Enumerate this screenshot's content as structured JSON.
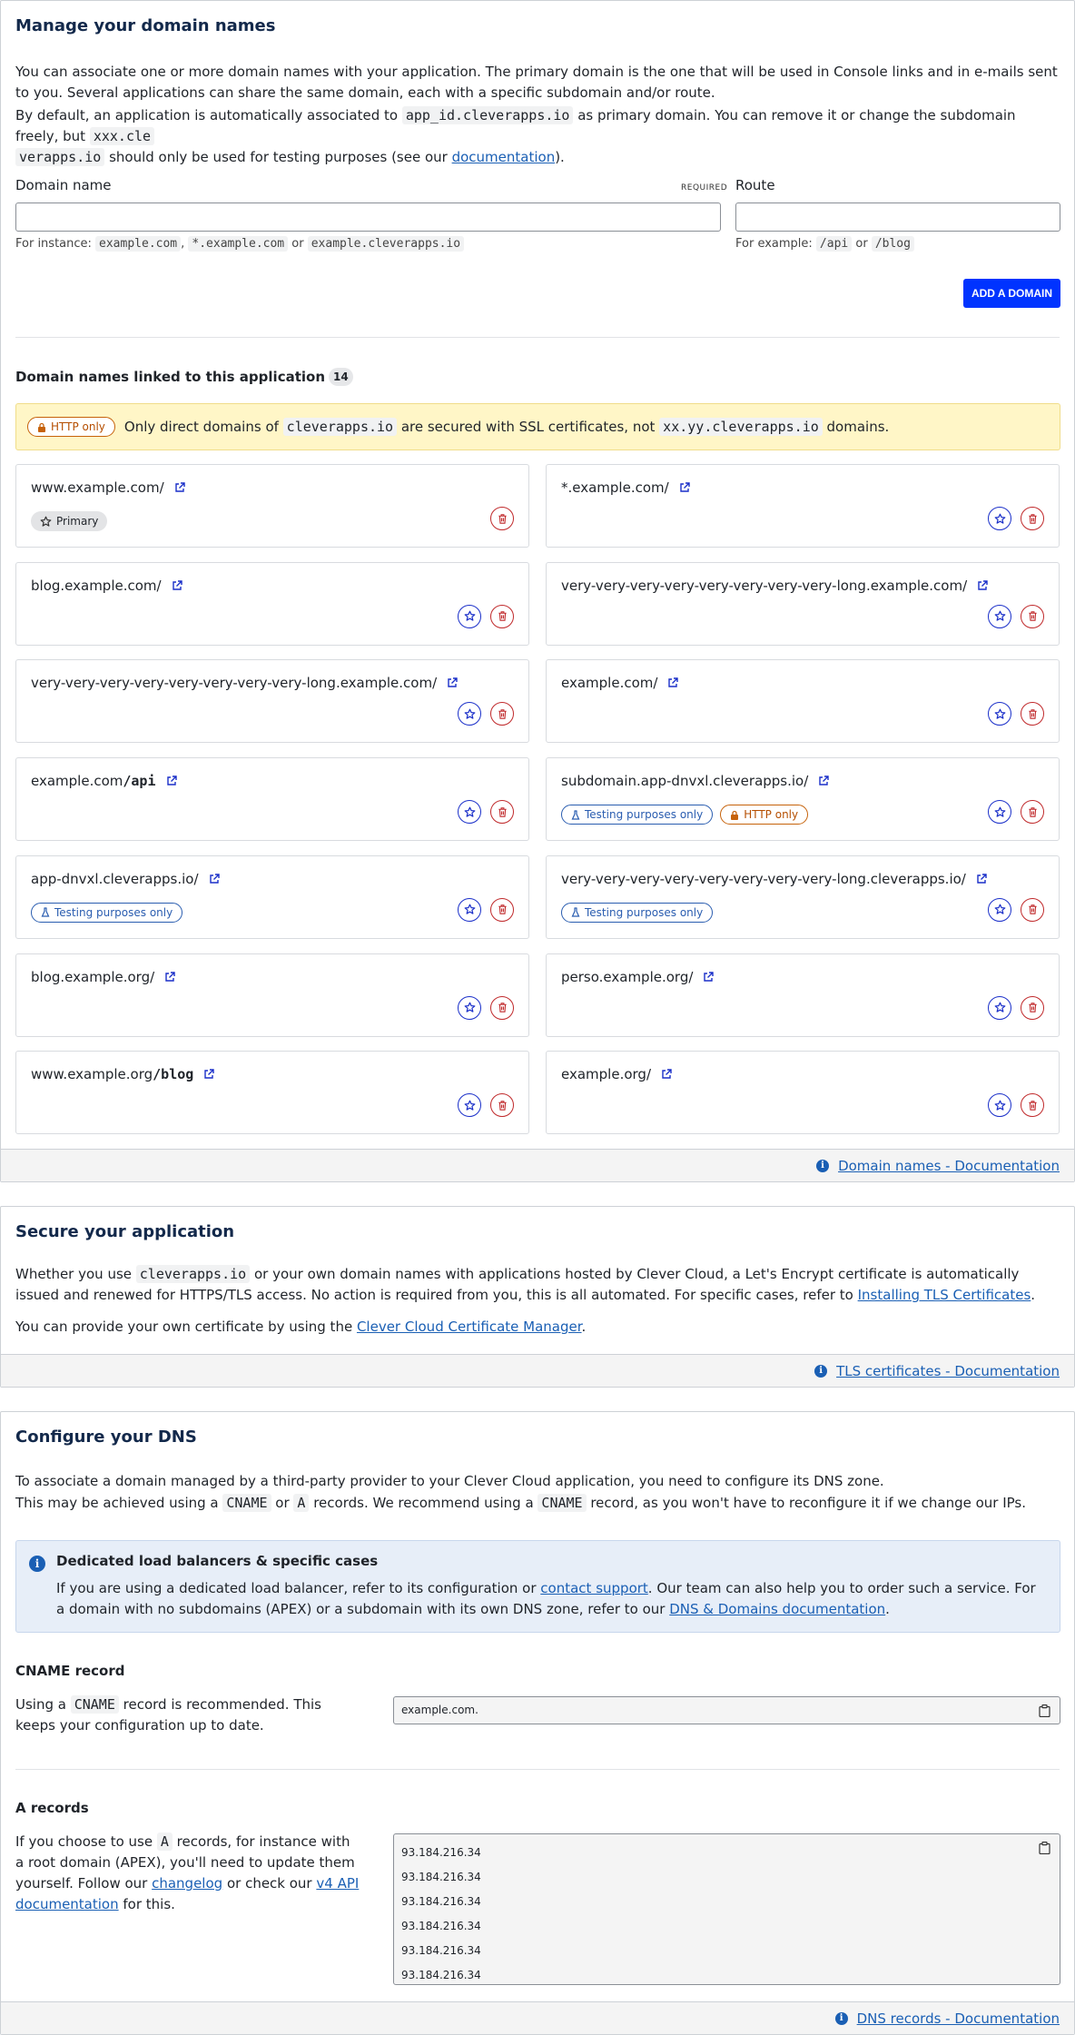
{
  "manage": {
    "title": "Manage your domain names",
    "intro1": "You can associate one or more domain names with your application. The primary domain is the one that will be used in Console links and in e-mails sent to you. Several applications can share the same domain, each with a specific subdomain and/or route.",
    "intro2_a": "By default, an application is automatically associated to ",
    "intro2_code1": "app_id.cleverapps.io",
    "intro2_b": " as primary domain. You can remove it or change the subdomain freely, but ",
    "intro2_code2a": "xxx.cle",
    "intro2_code2b": "verapps.io",
    "intro2_c": " should only be used for testing purposes (see our ",
    "intro2_link": "documentation",
    "intro2_d": ").",
    "domain_label": "Domain name",
    "required": "REQUIRED",
    "domain_value": "",
    "route_label": "Route",
    "route_value": "",
    "domain_hint_prefix": "For instance: ",
    "domain_hint_ex1": "example.com",
    "domain_hint_sep1": ", ",
    "domain_hint_ex2": "*.example.com",
    "domain_hint_sep2": " or ",
    "domain_hint_ex3": "example.cleverapps.io",
    "route_hint_prefix": "For example: ",
    "route_hint_ex1": "/api",
    "route_hint_sep": " or ",
    "route_hint_ex2": "/blog",
    "add_button": "ADD A DOMAIN",
    "linked_title": "Domain names linked to this application",
    "linked_count": "14",
    "warning_pill": "HTTP only",
    "warning_a": "Only direct domains of ",
    "warning_code1": "cleverapps.io",
    "warning_b": " are secured with SSL certificates, not ",
    "warning_code2": "xx.yy.cleverapps.io",
    "warning_c": " domains.",
    "footer_link": "Domain names - Documentation",
    "domains": [
      {
        "host": "www.example.com",
        "path": "/",
        "route": "",
        "pills": [
          {
            "type": "primary",
            "label": "Primary"
          }
        ],
        "primary": true
      },
      {
        "host": "*.example.com",
        "path": "/",
        "route": "",
        "pills": []
      },
      {
        "host": "blog.example.com",
        "path": "/",
        "route": "",
        "pills": []
      },
      {
        "host": "very-very-very-very-very-very-very-very-long.example.com",
        "path": "/",
        "route": "",
        "pills": []
      },
      {
        "host": "very-very-very-very-very-very-very-very-long.example.com",
        "path": "/",
        "route": "",
        "pills": []
      },
      {
        "host": "example.com",
        "path": "/",
        "route": "",
        "pills": []
      },
      {
        "host": "example.com",
        "path": "",
        "route": "/api",
        "pills": []
      },
      {
        "host": "subdomain.app-dnvxl.cleverapps.io",
        "path": "/",
        "route": "",
        "pills": [
          {
            "type": "test",
            "label": "Testing purposes only"
          },
          {
            "type": "http",
            "label": "HTTP only"
          }
        ]
      },
      {
        "host": "app-dnvxl.cleverapps.io",
        "path": "/",
        "route": "",
        "pills": [
          {
            "type": "test",
            "label": "Testing purposes only"
          }
        ]
      },
      {
        "host": "very-very-very-very-very-very-very-very-long.cleverapps.io",
        "path": "/",
        "route": "",
        "pills": [
          {
            "type": "test",
            "label": "Testing purposes only"
          }
        ]
      },
      {
        "host": "blog.example.org",
        "path": "/",
        "route": "",
        "pills": []
      },
      {
        "host": "perso.example.org",
        "path": "/",
        "route": "",
        "pills": []
      },
      {
        "host": "www.example.org",
        "path": "",
        "route": "/blog",
        "pills": []
      },
      {
        "host": "example.org",
        "path": "/",
        "route": "",
        "pills": []
      }
    ]
  },
  "secure": {
    "title": "Secure your application",
    "p1_a": "Whether you use ",
    "p1_code": "cleverapps.io",
    "p1_b": " or your own domain names with applications hosted by Clever Cloud, a Let's Encrypt certificate is automatically issued and renewed for HTTPS/TLS access. No action is required from you, this is all automated. For specific cases, refer to ",
    "p1_link": "Installing TLS Certificates",
    "p1_c": ".",
    "p2_a": "You can provide your own certificate by using the ",
    "p2_link": "Clever Cloud Certificate Manager",
    "p2_b": ".",
    "footer_link": "TLS certificates - Documentation"
  },
  "dns": {
    "title": "Configure your DNS",
    "p1": "To associate a domain managed by a third-party provider to your Clever Cloud application, you need to configure its DNS zone.",
    "p2_a": "This may be achieved using a ",
    "p2_code1": "CNAME",
    "p2_b": " or ",
    "p2_code2": "A",
    "p2_c": " records. We recommend using a ",
    "p2_code3": "CNAME",
    "p2_d": " record, as you won't have to reconfigure it if we change our IPs.",
    "box_title": "Dedicated load balancers & specific cases",
    "box_a": "If you are using a dedicated load balancer, refer to its configuration or ",
    "box_link1": "contact support",
    "box_b": ". Our team can also help you to order such a service. For a domain with no subdomains (APEX) or a subdomain with its own DNS zone, refer to our ",
    "box_link2": "DNS & Domains documentation",
    "box_c": ".",
    "cname_title": "CNAME record",
    "cname_a": "Using a ",
    "cname_code": "CNAME",
    "cname_b": " record is recommended. This keeps your configuration up to date.",
    "cname_value": "example.com.",
    "a_title": "A records",
    "a_a": "If you choose to use ",
    "a_code": "A",
    "a_b": " records, for instance with a root domain (APEX), you'll need to update them yourself. Follow our ",
    "a_link1": "changelog",
    "a_c": " or check our ",
    "a_link2": "v4 API documentation",
    "a_d": " for this.",
    "a_values": [
      "93.184.216.34",
      "93.184.216.34",
      "93.184.216.34",
      "93.184.216.34",
      "93.184.216.34",
      "93.184.216.34"
    ],
    "footer_link": "DNS records - Documentation"
  }
}
